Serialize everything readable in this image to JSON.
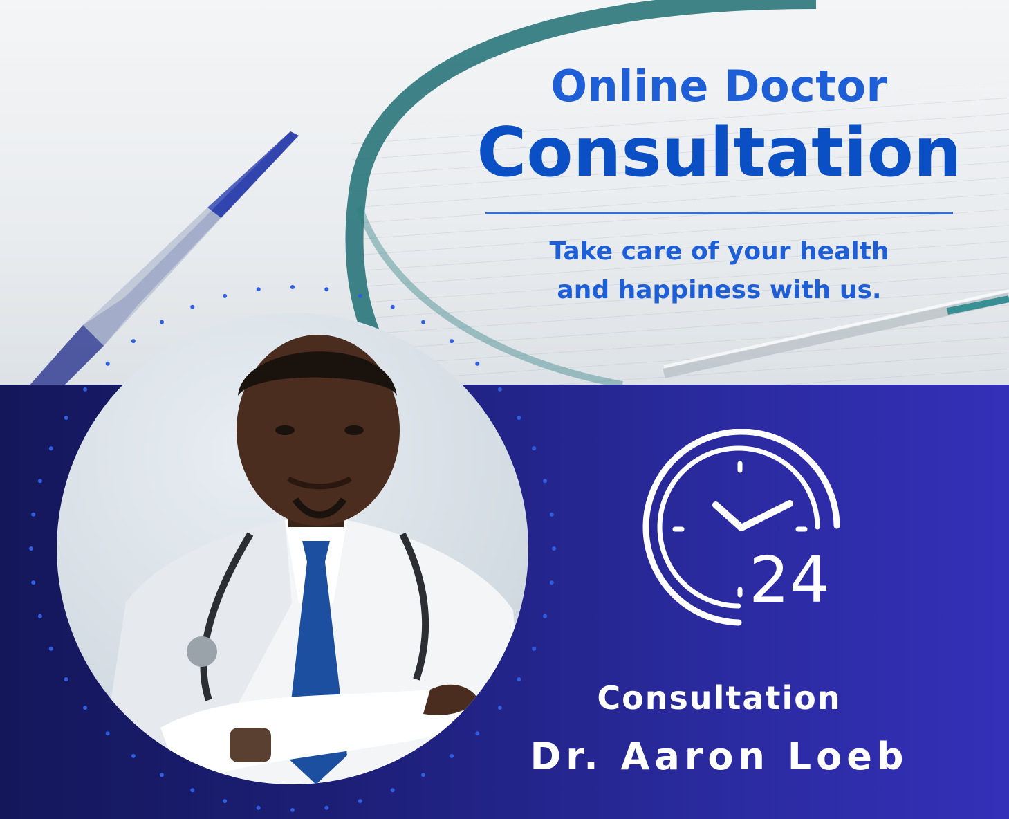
{
  "header": {
    "line1": "Online Doctor",
    "line2": "Consultation",
    "tagline_line1": "Take care of your health",
    "tagline_line2": "and happiness with us."
  },
  "clock_badge": {
    "number": "24",
    "icon": "clock-24-icon"
  },
  "footer": {
    "label": "Consultation",
    "doctor_name": "Dr. Aaron Loeb"
  },
  "colors": {
    "heading_blue": "#0b4fc4",
    "accent_blue": "#1e5fd8",
    "band_dark": "#14175a",
    "band_light": "#3430b8",
    "white": "#ffffff"
  }
}
